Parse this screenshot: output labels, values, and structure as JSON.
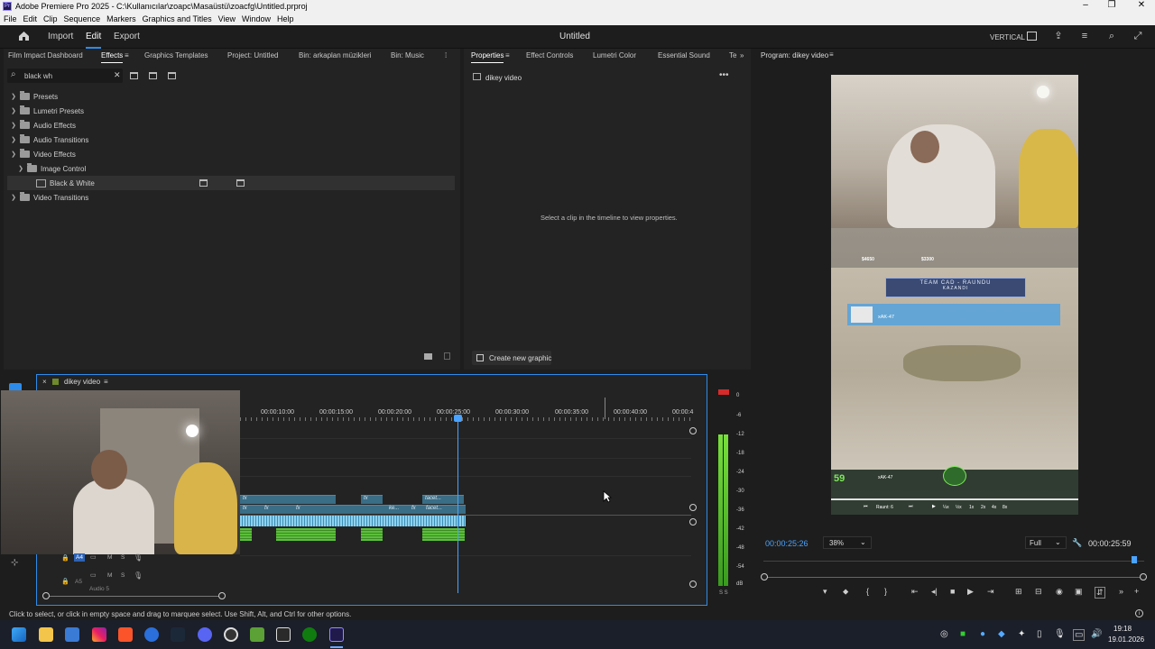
{
  "window": {
    "title": "Adobe Premiere Pro 2025 - C:\\Kullanıcılar\\zoapc\\Masaüstü\\zoacfg\\Untitled.prproj",
    "logo": "Pr",
    "minimize": "–",
    "maximize": "❐",
    "close": "✕"
  },
  "menu": [
    "File",
    "Edit",
    "Clip",
    "Sequence",
    "Markers",
    "Graphics and Titles",
    "View",
    "Window",
    "Help"
  ],
  "header": {
    "import": "Import",
    "edit": "Edit",
    "export": "Export",
    "project_title": "Untitled",
    "workspace": "VERTICAL"
  },
  "effects_panel": {
    "tabs": [
      "Film Impact Dashboard",
      "Effects",
      "Graphics Templates",
      "Project: Untitled",
      "Bin: arkaplan müzikleri",
      "Bin: Music"
    ],
    "search_value": "black wh",
    "tree": [
      {
        "label": "Presets",
        "indent": 0,
        "expanded": false
      },
      {
        "label": "Lumetri Presets",
        "indent": 0,
        "expanded": false
      },
      {
        "label": "Audio Effects",
        "indent": 0,
        "expanded": false
      },
      {
        "label": "Audio Transitions",
        "indent": 0,
        "expanded": false
      },
      {
        "label": "Video Effects",
        "indent": 0,
        "expanded": true
      },
      {
        "label": "Image Control",
        "indent": 1,
        "expanded": true
      },
      {
        "label": "Black & White",
        "indent": 2,
        "effect": true
      },
      {
        "label": "Video Transitions",
        "indent": 0,
        "expanded": false
      }
    ]
  },
  "properties_panel": {
    "tabs": [
      "Properties",
      "Effect Controls",
      "Lumetri Color",
      "Essential Sound",
      "Te"
    ],
    "item_name": "dikey video",
    "empty_message": "Select a clip in the timeline to view properties.",
    "create_button": "Create new graphic"
  },
  "program_monitor": {
    "tab": "Program: dikey video",
    "current_time": "00:00:25:26",
    "zoom": "38%",
    "resolution": "Full",
    "duration": "00:00:25:59",
    "video_overlay": {
      "banner_line1": "TEAM CAD - RAUNDU",
      "banner_line2": "KAZANDI",
      "player_tag": "xAK-47",
      "money": "$4650",
      "money2": "$3300",
      "score_left": "59",
      "round_text": "Raunt: 6",
      "speeds": [
        "¼x",
        "½x",
        "1x",
        "2x",
        "4x",
        "8x"
      ]
    }
  },
  "timeline": {
    "sequence_name": "dikey video",
    "ruler": [
      "00:00:10:00",
      "00:00:15:00",
      "00:00:20:00",
      "00:00:25:00",
      "00:00:30:00",
      "00:00:35:00",
      "00:00:40:00",
      "00:00:4"
    ],
    "clip_labels": [
      "fx",
      "fx",
      "fx",
      "fx",
      "fx",
      "facet...",
      "ke...",
      "fx",
      "facet..."
    ],
    "track_a4": "A4",
    "track_a5": "A5",
    "audio_label": "Audio 5",
    "meter_scale": [
      "0",
      "-6",
      "-12",
      "-18",
      "-24",
      "-30",
      "-36",
      "-42",
      "-48",
      "-54",
      "dB"
    ],
    "meter_footer": "S S"
  },
  "status_bar": "Click to select, or click in empty space and drag to marquee select. Use Shift, Alt, and Ctrl for other options.",
  "taskbar": {
    "time": "19:18",
    "date": "19.01.2026",
    "pinned": [
      "start-icon",
      "file-explorer-icon",
      "store-icon",
      "instagram-icon",
      "brave-icon",
      "app-icon",
      "steam-icon",
      "discord-icon",
      "obs-icon",
      "minecraft-icon",
      "epic-icon",
      "xbox-icon",
      "premiere-icon"
    ]
  },
  "colors": {
    "accent": "#2d8ceb",
    "clip_blue": "#3a6d86",
    "audio_green": "#5bbf3a",
    "playhead": "#4aa3ff",
    "taskbar": "#1b1f2a"
  }
}
